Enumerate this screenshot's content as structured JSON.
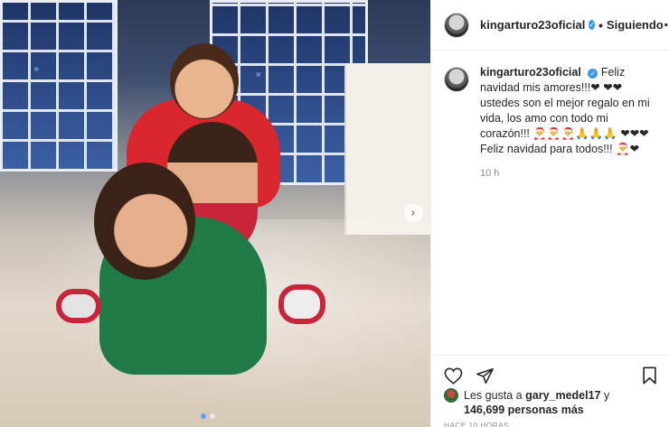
{
  "header": {
    "username": "kingarturo23oficial",
    "separator": "•",
    "follow_status": "Siguiendo",
    "more": "···"
  },
  "caption": {
    "username": "kingarturo23oficial",
    "text": "Feliz navidad mis amores!!!❤ ❤❤ ustedes son el mejor regalo en mi vida, los amo con todo mi corazón!!! 🎅🎅🎅🙏🙏🙏 ❤❤❤ Feliz navidad para todos!!! 🎅❤",
    "time": "10 h"
  },
  "likes": {
    "prefix": "Les gusta a",
    "liker": "gary_medel17",
    "conjunction": "y",
    "count": "146,699 personas más"
  },
  "posted_ago": "HACE 10 HORAS",
  "carousel": {
    "next": "›",
    "dots": 2,
    "active_index": 0
  },
  "colors": {
    "verified": "#3897f0",
    "text": "#262626",
    "muted": "#8e8e8e",
    "dot_active": "#5aa2ff"
  },
  "icons": [
    "heart-icon",
    "share-icon",
    "bookmark-icon",
    "more-icon",
    "verified-icon"
  ]
}
